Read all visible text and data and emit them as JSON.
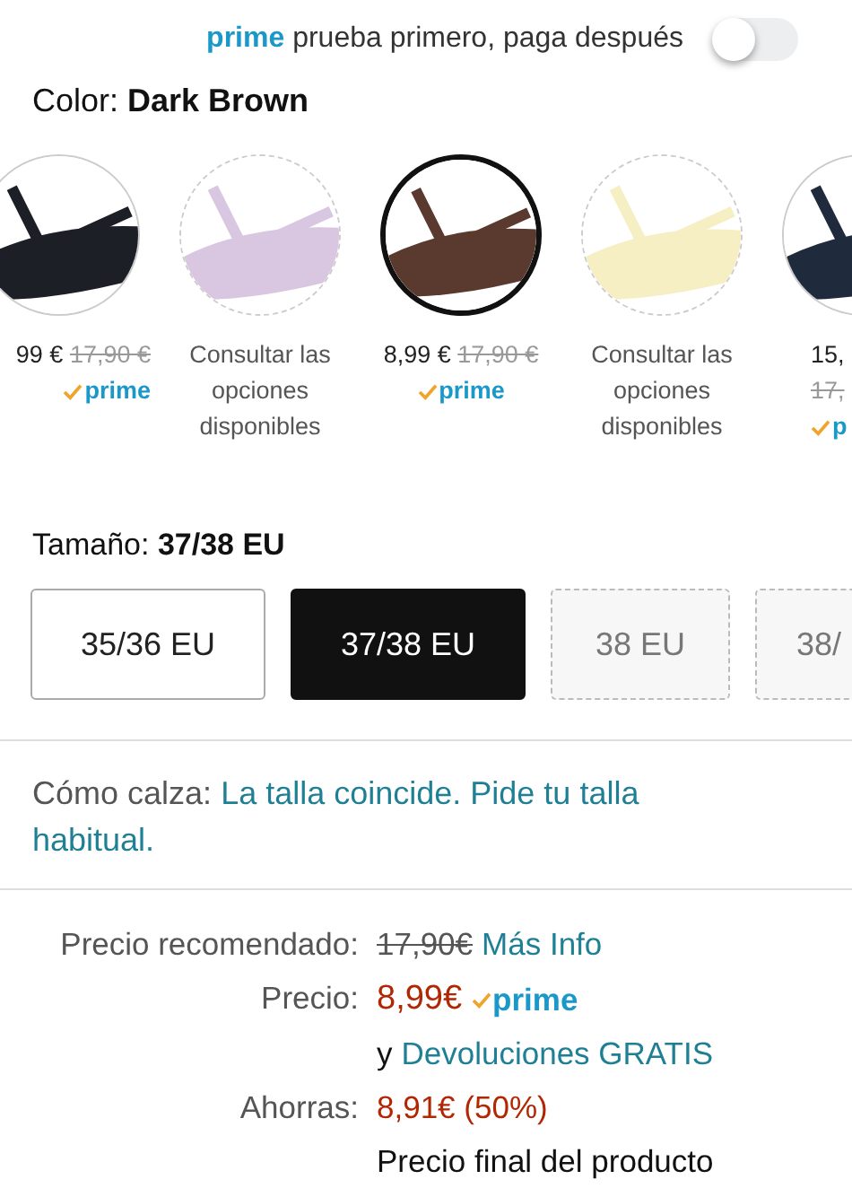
{
  "prime_banner": {
    "brand": "prime",
    "text": "prueba primero, paga después",
    "toggle_on": false
  },
  "color": {
    "label": "Color:",
    "value": "Dark Brown"
  },
  "swatches": [
    {
      "color": "#1c1f26",
      "selected": false,
      "available": true,
      "price": "99 €",
      "old_price": "17,90 €",
      "prime": "prime"
    },
    {
      "color": "#d9c6e0",
      "selected": false,
      "available": false,
      "note": "Consultar las opciones disponibles"
    },
    {
      "color": "#5a3a2e",
      "selected": true,
      "available": true,
      "price": "8,99 €",
      "old_price": "17,90 €",
      "prime": "prime"
    },
    {
      "color": "#f6efc4",
      "selected": false,
      "available": false,
      "note": "Consultar las opciones disponibles"
    },
    {
      "color": "#1f2a3d",
      "selected": false,
      "available": true,
      "price": "15,",
      "old_price": "17,",
      "prime": "p"
    }
  ],
  "size": {
    "label": "Tamaño:",
    "value": "37/38 EU"
  },
  "sizes": [
    {
      "label": "35/36 EU",
      "selected": false,
      "available": true
    },
    {
      "label": "37/38 EU",
      "selected": true,
      "available": true
    },
    {
      "label": "38 EU",
      "selected": false,
      "available": false
    },
    {
      "label": "38/",
      "selected": false,
      "available": false
    }
  ],
  "fit": {
    "label": "Cómo calza:",
    "link": "La talla coincide. Pide tu talla habitual."
  },
  "pricing": {
    "list_label": "Precio recomendado:",
    "list_price": "17,90€",
    "info_link": "Más Info",
    "price_label": "Precio:",
    "price": "8,99€",
    "prime": "prime",
    "returns_prefix": "y",
    "returns_link": "Devoluciones GRATIS",
    "savings_label": "Ahorras:",
    "savings": "8,91€ (50%)",
    "final_note": "Precio final del producto"
  }
}
